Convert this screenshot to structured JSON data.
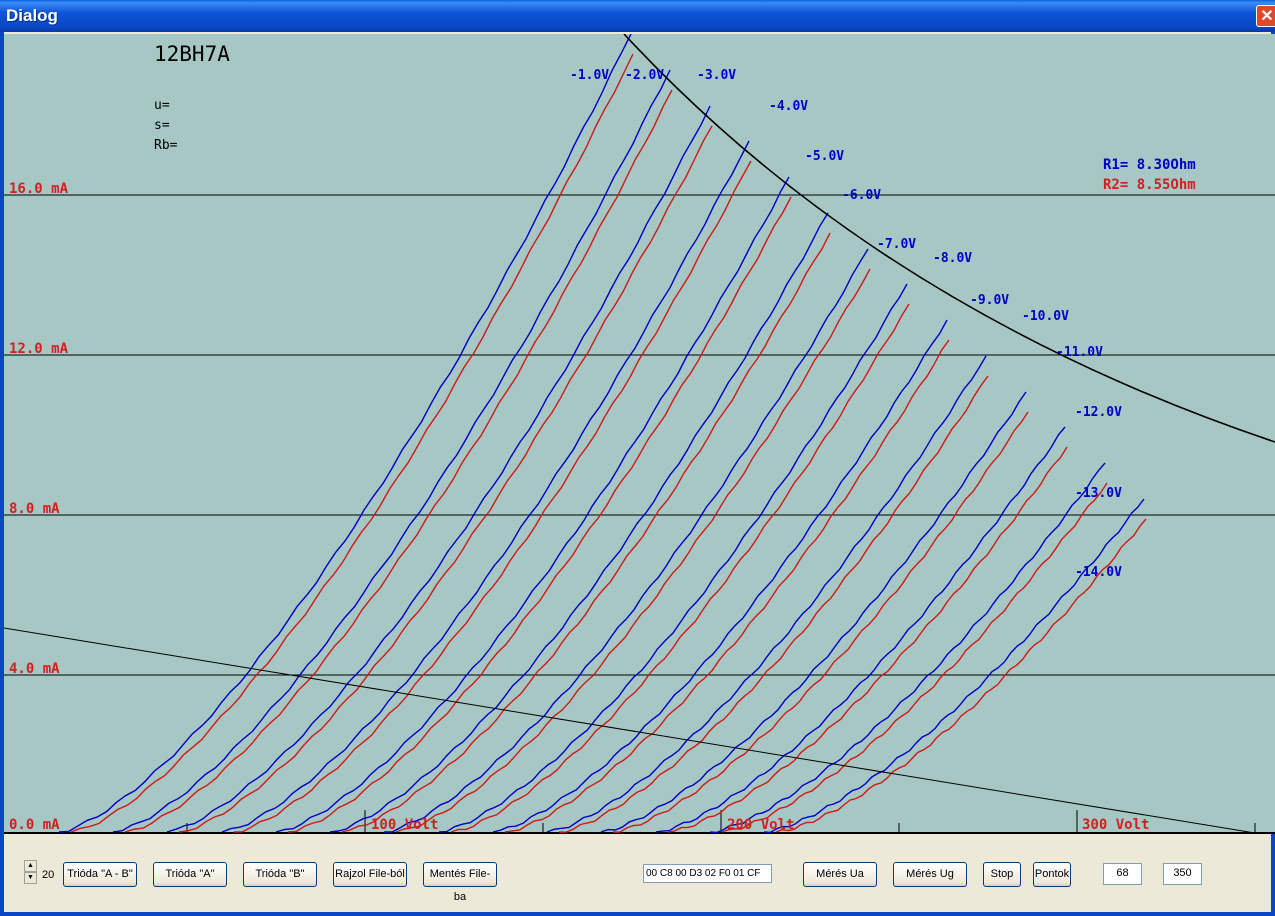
{
  "window": {
    "title": "Dialog",
    "close_glyph": "✕"
  },
  "plot": {
    "tube_name": "12BH7A",
    "params": [
      "u=",
      "s=",
      "Rb="
    ],
    "r1_label": "R1= 8.30Ohm",
    "r2_label": "R2= 8.55Ohm",
    "y_labels": [
      "16.0 mA",
      "12.0 mA",
      "8.0 mA",
      "4.0 mA",
      "0.0 mA"
    ],
    "x_labels": [
      "100 Volt",
      "200 Volt",
      "300 Volt"
    ],
    "grid_labels": [
      "-1.0V",
      "-2.0V",
      "-3.0V",
      "-4.0V",
      "-5.0V",
      "-6.0V",
      "-7.0V",
      "-8.0V",
      "-9.0V",
      "-10.0V",
      "-11.0V",
      "-12.0V",
      "-13.0V",
      "-14.0V"
    ],
    "colors": {
      "background": "#a6c7c3",
      "blue_trace": "#0000c8",
      "red_trace": "#d01818",
      "axis_label": "#d02020",
      "grid_label": "#0000c8"
    }
  },
  "toolbar": {
    "spinner_value": "20",
    "buttons": {
      "trioda_ab": "Trióda \"A - B\"",
      "trioda_a": "Trióda  \"A\"",
      "trioda_b": "Trióda  \"B\"",
      "rajzol": "Rajzol File-ból",
      "mentes": "Mentés File-ba",
      "meres_ua": "Mérés Ua",
      "meres_ug": "Mérés Ug",
      "stop": "Stop",
      "pontok": "Pontok"
    },
    "hex_field_value": "00 C8 00 D3 02 F0 01 CF",
    "field_1_value": "68",
    "field_2_value": "350"
  }
}
